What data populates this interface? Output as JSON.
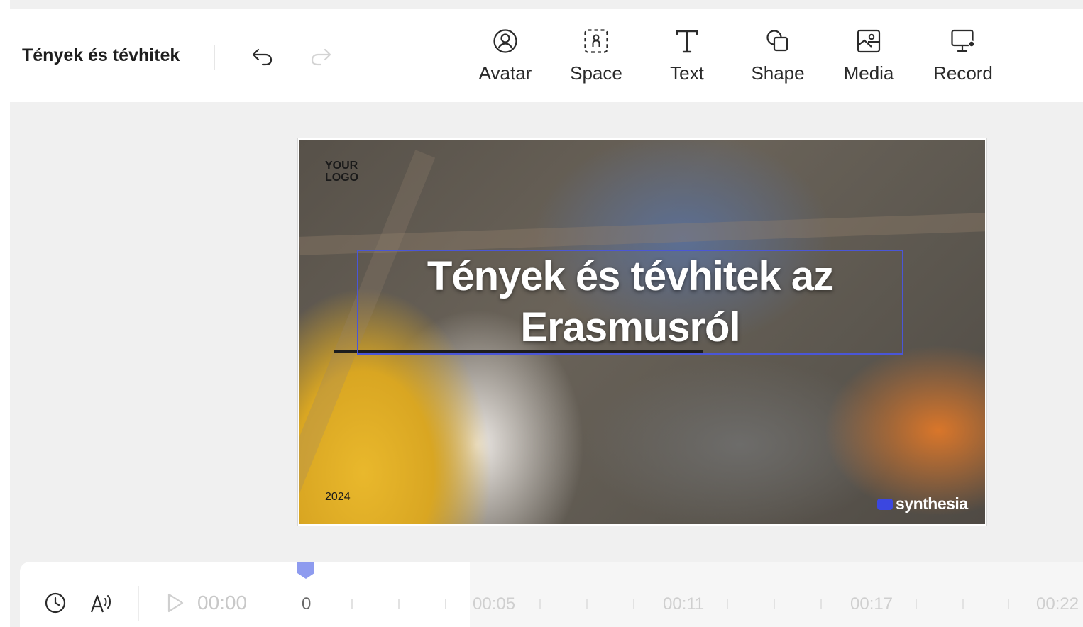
{
  "project": {
    "title": "Tények és tévhitek"
  },
  "history": {
    "undo": "undo-icon",
    "redo": "redo-icon"
  },
  "tools": [
    {
      "label": "Avatar",
      "icon": "avatar-icon"
    },
    {
      "label": "Space",
      "icon": "space-icon"
    },
    {
      "label": "Text",
      "icon": "text-icon"
    },
    {
      "label": "Shape",
      "icon": "shape-icon"
    },
    {
      "label": "Media",
      "icon": "media-icon"
    },
    {
      "label": "Record",
      "icon": "record-icon"
    }
  ],
  "slide": {
    "logo_placeholder": "YOUR\nLOGO",
    "title": "Tények és tévhitek az Erasmusról",
    "year": "2024",
    "brand": "synthesia"
  },
  "timeline": {
    "current_time": "00:00",
    "ticks": [
      "0",
      "00:05",
      "00:11",
      "00:17",
      "00:22"
    ]
  },
  "colors": {
    "accent": "#4a56d8",
    "playhead": "#8e9bef",
    "stage_bg": "#f0f0f0"
  }
}
